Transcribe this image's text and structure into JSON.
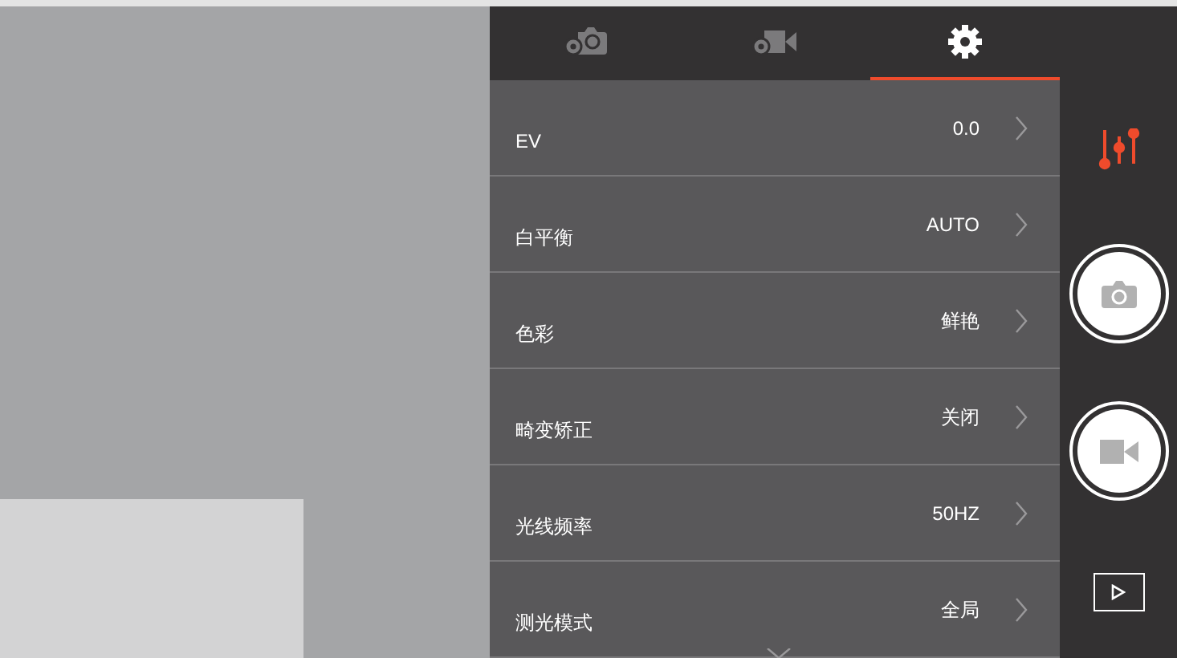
{
  "tabs": [
    {
      "kind": "photo-settings",
      "selected": false
    },
    {
      "kind": "video-settings",
      "selected": false
    },
    {
      "kind": "settings",
      "selected": true
    }
  ],
  "settings": [
    {
      "label": "EV",
      "value": "0.0"
    },
    {
      "label": "白平衡",
      "value": "AUTO"
    },
    {
      "label": "色彩",
      "value": "鲜艳"
    },
    {
      "label": "畸变矫正",
      "value": "关闭"
    },
    {
      "label": "光线频率",
      "value": "50HZ"
    },
    {
      "label": "测光模式",
      "value": "全局"
    }
  ]
}
